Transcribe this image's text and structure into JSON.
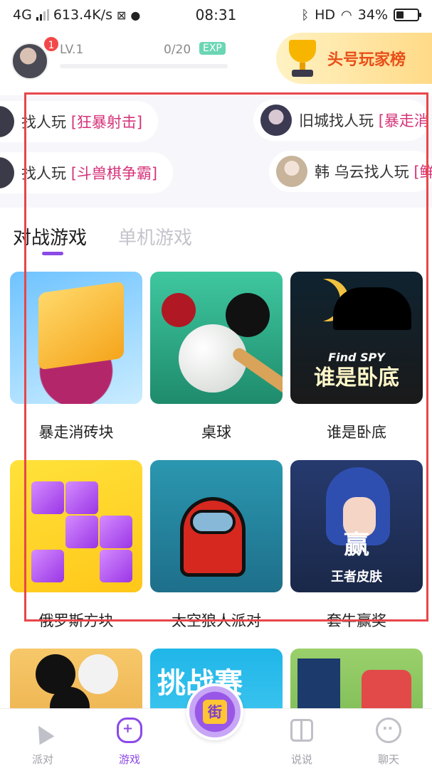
{
  "status_bar": {
    "network": "4G",
    "speed": "613.4K/s",
    "time": "08:31",
    "hd": "HD",
    "battery": "34%",
    "battery_level": 0.34
  },
  "user": {
    "notification_count": "1",
    "level": "LV.1",
    "exp_progress": "0/20",
    "exp_tag": "EXP",
    "exp_fraction": 0.0
  },
  "rank_button": {
    "label": "头号玩家榜",
    "icon": "trophy-icon"
  },
  "find_players": [
    {
      "text": "找人玩",
      "tag": "[狂暴射击]"
    },
    {
      "text": "旧城找人玩",
      "tag": "[暴走消"
    },
    {
      "text": "找人玩",
      "tag": "[斗兽棋争霸]"
    },
    {
      "text": "韩 乌云找人玩",
      "tag": "[鲜"
    }
  ],
  "tabs": {
    "active": "对战游戏",
    "inactive": "单机游戏"
  },
  "games": [
    {
      "name": "暴走消砖块"
    },
    {
      "name": "桌球"
    },
    {
      "name": "谁是卧底",
      "art_subtitle": "Find SPY",
      "art_title": "谁是卧底"
    },
    {
      "name": "俄罗斯方块"
    },
    {
      "name": "太空狼人派对"
    },
    {
      "name": "套牛赢奖",
      "art_big": "赢",
      "art_small": "王者皮肤"
    },
    {
      "art_label": "挑战赛"
    }
  ],
  "bottom_nav": {
    "party": "派对",
    "games": "游戏",
    "center": "街",
    "moments": "说说",
    "chat": "聊天"
  },
  "colors": {
    "accent": "#8b4ae6",
    "tag_pink": "#d5337a",
    "rank_text": "#e94e19",
    "highlight": "#e8464a"
  }
}
